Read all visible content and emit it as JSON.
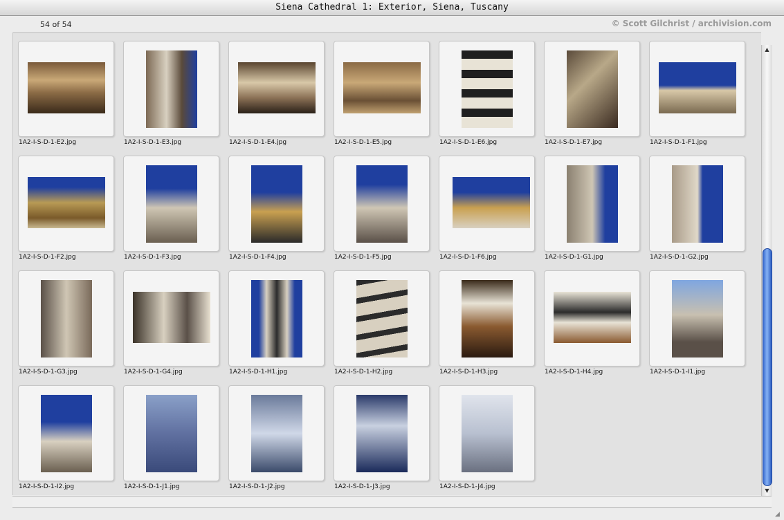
{
  "window": {
    "title": "Siena Cathedral 1: Exterior, Siena, Tuscany"
  },
  "header": {
    "count": "54 of 54",
    "credit": "© Scott Gilchrist / archivision.com"
  },
  "icons": {
    "scroll_up": "scroll-up-arrow-icon",
    "scroll_down": "scroll-down-arrow-icon",
    "resize": "resize-grip-icon"
  },
  "colors": {
    "sky": "#1f3f9f",
    "marble_dark": "#2b2b2b",
    "marble_light": "#e8e3d6",
    "scroll_thumb": "#3a6cd0"
  },
  "thumbnails": [
    {
      "filename": "1A2-I-S-D-1-E2.jpg"
    },
    {
      "filename": "1A2-I-S-D-1-E3.jpg"
    },
    {
      "filename": "1A2-I-S-D-1-E4.jpg"
    },
    {
      "filename": "1A2-I-S-D-1-E5.jpg"
    },
    {
      "filename": "1A2-I-S-D-1-E6.jpg"
    },
    {
      "filename": "1A2-I-S-D-1-E7.jpg"
    },
    {
      "filename": "1A2-I-S-D-1-F1.jpg"
    },
    {
      "filename": "1A2-I-S-D-1-F2.jpg"
    },
    {
      "filename": "1A2-I-S-D-1-F3.jpg"
    },
    {
      "filename": "1A2-I-S-D-1-F4.jpg"
    },
    {
      "filename": "1A2-I-S-D-1-F5.jpg"
    },
    {
      "filename": "1A2-I-S-D-1-F6.jpg"
    },
    {
      "filename": "1A2-I-S-D-1-G1.jpg"
    },
    {
      "filename": "1A2-I-S-D-1-G2.jpg"
    },
    {
      "filename": "1A2-I-S-D-1-G3.jpg"
    },
    {
      "filename": "1A2-I-S-D-1-G4.jpg"
    },
    {
      "filename": "1A2-I-S-D-1-H1.jpg"
    },
    {
      "filename": "1A2-I-S-D-1-H2.jpg"
    },
    {
      "filename": "1A2-I-S-D-1-H3.jpg"
    },
    {
      "filename": "1A2-I-S-D-1-H4.jpg"
    },
    {
      "filename": "1A2-I-S-D-1-I1.jpg"
    },
    {
      "filename": "1A2-I-S-D-1-I2.jpg"
    },
    {
      "filename": "1A2-I-S-D-1-J1.jpg"
    },
    {
      "filename": "1A2-I-S-D-1-J2.jpg"
    },
    {
      "filename": "1A2-I-S-D-1-J3.jpg"
    },
    {
      "filename": "1A2-I-S-D-1-J4.jpg"
    }
  ]
}
